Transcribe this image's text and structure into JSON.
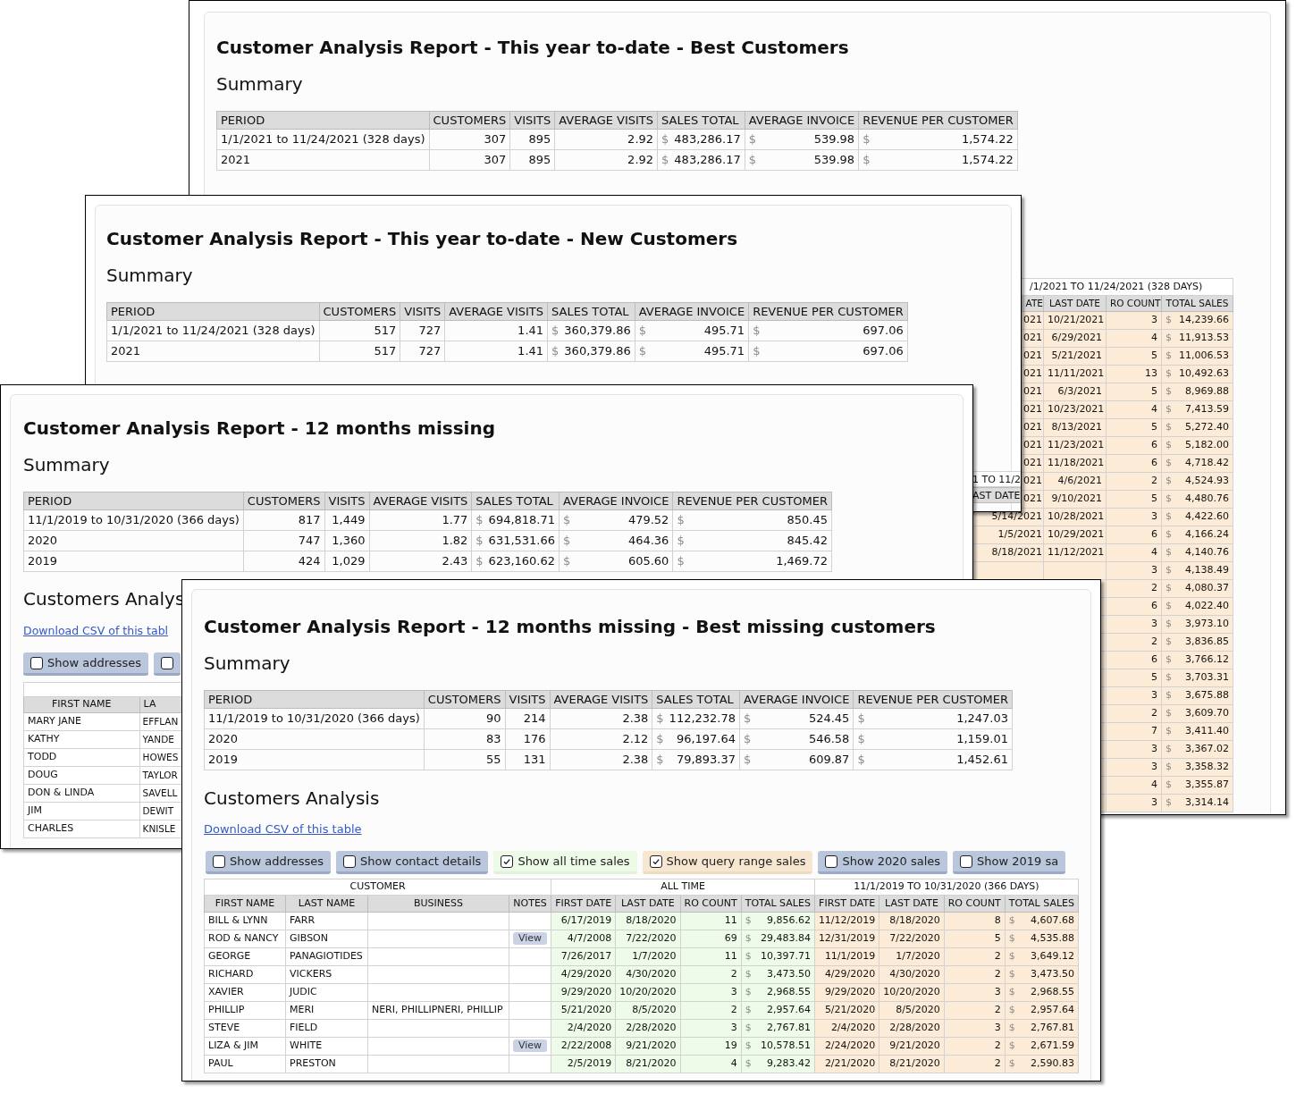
{
  "report_best_customers": {
    "title": "Customer Analysis Report - This year to-date - Best Customers",
    "summary_heading": "Summary",
    "summary_table": {
      "columns": [
        "PERIOD",
        "CUSTOMERS",
        "VISITS",
        "AVERAGE VISITS",
        "SALES TOTAL",
        "AVERAGE INVOICE",
        "REVENUE PER CUSTOMER"
      ],
      "rows": [
        [
          "1/1/2021 to 11/24/2021 (328 days)",
          "307",
          "895",
          "2.92",
          {
            "symbol": "$",
            "amount": "483,286.17"
          },
          {
            "symbol": "$",
            "amount": "539.98"
          },
          {
            "symbol": "$",
            "amount": "1,574.22"
          }
        ],
        [
          "2021",
          "307",
          "895",
          "2.92",
          {
            "symbol": "$",
            "amount": "483,286.17"
          },
          {
            "symbol": "$",
            "amount": "539.98"
          },
          {
            "symbol": "$",
            "amount": "1,574.22"
          }
        ]
      ]
    },
    "sales_table": {
      "range_header": "/1/2021 TO 11/24/2021 (328 DAYS)",
      "columns": [
        "ATE",
        "LAST DATE",
        "RO COUNT",
        "TOTAL SALES"
      ],
      "rows": [
        {
          "first_date": "021",
          "last_date": "10/21/2021",
          "ro_count": "3",
          "total_sales": {
            "symbol": "$",
            "amount": "14,239.66"
          }
        },
        {
          "first_date": "021",
          "last_date": "6/29/2021",
          "ro_count": "4",
          "total_sales": {
            "symbol": "$",
            "amount": "11,913.53"
          }
        },
        {
          "first_date": "021",
          "last_date": "5/21/2021",
          "ro_count": "5",
          "total_sales": {
            "symbol": "$",
            "amount": "11,006.53"
          }
        },
        {
          "first_date": "021",
          "last_date": "11/11/2021",
          "ro_count": "13",
          "total_sales": {
            "symbol": "$",
            "amount": "10,492.63"
          }
        },
        {
          "first_date": "021",
          "last_date": "6/3/2021",
          "ro_count": "5",
          "total_sales": {
            "symbol": "$",
            "amount": "8,969.88"
          }
        },
        {
          "first_date": "021",
          "last_date": "10/23/2021",
          "ro_count": "4",
          "total_sales": {
            "symbol": "$",
            "amount": "7,413.59"
          }
        },
        {
          "first_date": "021",
          "last_date": "8/13/2021",
          "ro_count": "5",
          "total_sales": {
            "symbol": "$",
            "amount": "5,272.40"
          }
        },
        {
          "first_date": "021",
          "last_date": "11/23/2021",
          "ro_count": "6",
          "total_sales": {
            "symbol": "$",
            "amount": "5,182.00"
          }
        },
        {
          "first_date": "021",
          "last_date": "11/18/2021",
          "ro_count": "6",
          "total_sales": {
            "symbol": "$",
            "amount": "4,718.42"
          }
        },
        {
          "first_date": "021",
          "last_date": "4/6/2021",
          "ro_count": "2",
          "total_sales": {
            "symbol": "$",
            "amount": "4,524.93"
          }
        },
        {
          "first_date": "021",
          "last_date": "9/10/2021",
          "ro_count": "5",
          "total_sales": {
            "symbol": "$",
            "amount": "4,480.76"
          }
        },
        {
          "first_date": "5/14/2021",
          "last_date": "10/28/2021",
          "ro_count": "3",
          "total_sales": {
            "symbol": "$",
            "amount": "4,422.60"
          }
        },
        {
          "first_date": "1/5/2021",
          "last_date": "10/29/2021",
          "ro_count": "6",
          "total_sales": {
            "symbol": "$",
            "amount": "4,166.24"
          }
        },
        {
          "first_date": "8/18/2021",
          "last_date": "11/12/2021",
          "ro_count": "4",
          "total_sales": {
            "symbol": "$",
            "amount": "4,140.76"
          }
        },
        {
          "ro_count": "3",
          "total_sales": {
            "symbol": "$",
            "amount": "4,138.49"
          }
        },
        {
          "ro_count": "2",
          "total_sales": {
            "symbol": "$",
            "amount": "4,080.37"
          }
        },
        {
          "ro_count": "6",
          "total_sales": {
            "symbol": "$",
            "amount": "4,022.40"
          }
        },
        {
          "ro_count": "3",
          "total_sales": {
            "symbol": "$",
            "amount": "3,973.10"
          }
        },
        {
          "ro_count": "2",
          "total_sales": {
            "symbol": "$",
            "amount": "3,836.85"
          }
        },
        {
          "ro_count": "6",
          "total_sales": {
            "symbol": "$",
            "amount": "3,766.12"
          }
        },
        {
          "ro_count": "5",
          "total_sales": {
            "symbol": "$",
            "amount": "3,703.31"
          }
        },
        {
          "ro_count": "3",
          "total_sales": {
            "symbol": "$",
            "amount": "3,675.88"
          }
        },
        {
          "ro_count": "2",
          "total_sales": {
            "symbol": "$",
            "amount": "3,609.70"
          }
        },
        {
          "ro_count": "7",
          "total_sales": {
            "symbol": "$",
            "amount": "3,411.40"
          }
        },
        {
          "ro_count": "3",
          "total_sales": {
            "symbol": "$",
            "amount": "3,367.02"
          }
        },
        {
          "ro_count": "3",
          "total_sales": {
            "symbol": "$",
            "amount": "3,358.32"
          }
        },
        {
          "ro_count": "4",
          "total_sales": {
            "symbol": "$",
            "amount": "3,355.87"
          }
        },
        {
          "ro_count": "3",
          "total_sales": {
            "symbol": "$",
            "amount": "3,314.14"
          }
        }
      ]
    }
  },
  "report_new_customers": {
    "title": "Customer Analysis Report - This year to-date - New Customers",
    "summary_heading": "Summary",
    "summary_table": {
      "columns": [
        "PERIOD",
        "CUSTOMERS",
        "VISITS",
        "AVERAGE VISITS",
        "SALES TOTAL",
        "AVERAGE INVOICE",
        "REVENUE PER CUSTOMER"
      ],
      "rows": [
        [
          "1/1/2021 to 11/24/2021 (328 days)",
          "517",
          "727",
          "1.41",
          {
            "symbol": "$",
            "amount": "360,379.86"
          },
          {
            "symbol": "$",
            "amount": "495.71"
          },
          {
            "symbol": "$",
            "amount": "697.06"
          }
        ],
        [
          "2021",
          "517",
          "727",
          "1.41",
          {
            "symbol": "$",
            "amount": "360,379.86"
          },
          {
            "symbol": "$",
            "amount": "495.71"
          },
          {
            "symbol": "$",
            "amount": "697.06"
          }
        ]
      ]
    },
    "table_fragment": {
      "range_header": "1 TO 11/2",
      "column": "AST DATE"
    }
  },
  "report_missing": {
    "title": "Customer Analysis Report - 12 months missing",
    "summary_heading": "Summary",
    "summary_table": {
      "columns": [
        "PERIOD",
        "CUSTOMERS",
        "VISITS",
        "AVERAGE VISITS",
        "SALES TOTAL",
        "AVERAGE INVOICE",
        "REVENUE PER CUSTOMER"
      ],
      "rows": [
        [
          "11/1/2019 to 10/31/2020 (366 days)",
          "817",
          "1,449",
          "1.77",
          {
            "symbol": "$",
            "amount": "694,818.71"
          },
          {
            "symbol": "$",
            "amount": "479.52"
          },
          {
            "symbol": "$",
            "amount": "850.45"
          }
        ],
        [
          "2020",
          "747",
          "1,360",
          "1.82",
          {
            "symbol": "$",
            "amount": "631,531.66"
          },
          {
            "symbol": "$",
            "amount": "464.36"
          },
          {
            "symbol": "$",
            "amount": "845.42"
          }
        ],
        [
          "2019",
          "424",
          "1,029",
          "2.43",
          {
            "symbol": "$",
            "amount": "623,160.62"
          },
          {
            "symbol": "$",
            "amount": "605.60"
          },
          {
            "symbol": "$",
            "amount": "1,469.72"
          }
        ]
      ]
    },
    "analysis_heading": "Customers Analys",
    "download_link": "Download CSV of this tabl",
    "buttons": [
      {
        "label": "Show addresses",
        "checked": false,
        "kind": "plain"
      },
      {
        "checked": false,
        "kind": "plain"
      }
    ],
    "customers_table": {
      "columns": [
        "FIRST NAME",
        "LA"
      ],
      "rows": [
        {
          "first_name": "MARY JANE",
          "last_name": "EFFLAN"
        },
        {
          "first_name": "KATHY",
          "last_name": "YANDE"
        },
        {
          "first_name": "TODD",
          "last_name": "HOWES"
        },
        {
          "first_name": "DOUG",
          "last_name": "TAYLOR"
        },
        {
          "first_name": "DON & LINDA",
          "last_name": "SAVELL"
        },
        {
          "first_name": "JIM",
          "last_name": "DEWIT"
        },
        {
          "first_name": "CHARLES",
          "last_name": "KNISLE"
        }
      ]
    }
  },
  "report_best_missing": {
    "title": "Customer Analysis Report - 12 months missing - Best missing customers",
    "summary_heading": "Summary",
    "summary_table": {
      "columns": [
        "PERIOD",
        "CUSTOMERS",
        "VISITS",
        "AVERAGE VISITS",
        "SALES TOTAL",
        "AVERAGE INVOICE",
        "REVENUE PER CUSTOMER"
      ],
      "rows": [
        [
          "11/1/2019 to 10/31/2020 (366 days)",
          "90",
          "214",
          "2.38",
          {
            "symbol": "$",
            "amount": "112,232.78"
          },
          {
            "symbol": "$",
            "amount": "524.45"
          },
          {
            "symbol": "$",
            "amount": "1,247.03"
          }
        ],
        [
          "2020",
          "83",
          "176",
          "2.12",
          {
            "symbol": "$",
            "amount": "96,197.64"
          },
          {
            "symbol": "$",
            "amount": "546.58"
          },
          {
            "symbol": "$",
            "amount": "1,159.01"
          }
        ],
        [
          "2019",
          "55",
          "131",
          "2.38",
          {
            "symbol": "$",
            "amount": "79,893.37"
          },
          {
            "symbol": "$",
            "amount": "609.87"
          },
          {
            "symbol": "$",
            "amount": "1,452.61"
          }
        ]
      ]
    },
    "analysis_heading": "Customers Analysis",
    "download_link": "Download CSV of this table",
    "buttons": [
      {
        "label": "Show addresses",
        "checked": false,
        "kind": "plain"
      },
      {
        "label": "Show contact details",
        "checked": false,
        "kind": "plain"
      },
      {
        "label": "Show all time sales",
        "checked": true,
        "kind": "all_time"
      },
      {
        "label": "Show query range sales",
        "checked": true,
        "kind": "query_range"
      },
      {
        "label": "Show 2020 sales",
        "checked": false,
        "kind": "plain"
      },
      {
        "label": "Show 2019 sa",
        "checked": false,
        "kind": "plain"
      }
    ],
    "customers_table": {
      "groups": [
        {
          "label": "CUSTOMER",
          "kind": "customer",
          "columns": [
            "FIRST NAME",
            "LAST NAME",
            "BUSINESS",
            "NOTES"
          ]
        },
        {
          "label": "ALL TIME",
          "kind": "all_time",
          "columns": [
            "FIRST DATE",
            "LAST DATE",
            "RO COUNT",
            "TOTAL SALES"
          ]
        },
        {
          "label": "11/1/2019 TO 10/31/2020 (366 DAYS)",
          "kind": "query_range",
          "columns": [
            "FIRST DATE",
            "LAST DATE",
            "RO COUNT",
            "TOTAL SALES"
          ]
        }
      ],
      "rows": [
        {
          "first_name": "BILL & LYNN",
          "last_name": "FARR",
          "all_time": [
            "6/17/2019",
            "8/18/2020",
            "11",
            {
              "symbol": "$",
              "amount": "9,856.62"
            }
          ],
          "query_range": [
            "11/12/2019",
            "8/18/2020",
            "8",
            {
              "symbol": "$",
              "amount": "4,607.68"
            }
          ]
        },
        {
          "first_name": "ROD & NANCY",
          "last_name": "GIBSON",
          "notes_button": "View",
          "all_time": [
            "4/7/2008",
            "7/22/2020",
            "69",
            {
              "symbol": "$",
              "amount": "29,483.84"
            }
          ],
          "query_range": [
            "12/31/2019",
            "7/22/2020",
            "5",
            {
              "symbol": "$",
              "amount": "4,535.88"
            }
          ]
        },
        {
          "first_name": "GEORGE",
          "last_name": "PANAGIOTIDES",
          "all_time": [
            "7/26/2017",
            "1/7/2020",
            "11",
            {
              "symbol": "$",
              "amount": "10,397.71"
            }
          ],
          "query_range": [
            "11/1/2019",
            "1/7/2020",
            "2",
            {
              "symbol": "$",
              "amount": "3,649.12"
            }
          ]
        },
        {
          "first_name": "RICHARD",
          "last_name": "VICKERS",
          "all_time": [
            "4/29/2020",
            "4/30/2020",
            "2",
            {
              "symbol": "$",
              "amount": "3,473.50"
            }
          ],
          "query_range": [
            "4/29/2020",
            "4/30/2020",
            "2",
            {
              "symbol": "$",
              "amount": "3,473.50"
            }
          ]
        },
        {
          "first_name": "XAVIER",
          "last_name": "JUDIC",
          "all_time": [
            "9/29/2020",
            "10/20/2020",
            "3",
            {
              "symbol": "$",
              "amount": "2,968.55"
            }
          ],
          "query_range": [
            "9/29/2020",
            "10/20/2020",
            "3",
            {
              "symbol": "$",
              "amount": "2,968.55"
            }
          ]
        },
        {
          "first_name": "PHILLIP",
          "last_name": "MERI",
          "business": "NERI, PHILLIPNERI, PHILLIP",
          "all_time": [
            "5/21/2020",
            "8/5/2020",
            "2",
            {
              "symbol": "$",
              "amount": "2,957.64"
            }
          ],
          "query_range": [
            "5/21/2020",
            "8/5/2020",
            "2",
            {
              "symbol": "$",
              "amount": "2,957.64"
            }
          ]
        },
        {
          "first_name": "STEVE",
          "last_name": "FIELD",
          "all_time": [
            "2/4/2020",
            "2/28/2020",
            "3",
            {
              "symbol": "$",
              "amount": "2,767.81"
            }
          ],
          "query_range": [
            "2/4/2020",
            "2/28/2020",
            "3",
            {
              "symbol": "$",
              "amount": "2,767.81"
            }
          ]
        },
        {
          "first_name": "LIZA & JIM",
          "last_name": "WHITE",
          "notes_button": "View",
          "all_time": [
            "2/22/2008",
            "9/21/2020",
            "19",
            {
              "symbol": "$",
              "amount": "10,578.51"
            }
          ],
          "query_range": [
            "2/24/2020",
            "9/21/2020",
            "2",
            {
              "symbol": "$",
              "amount": "2,671.59"
            }
          ]
        },
        {
          "first_name": "PAUL",
          "last_name": "PRESTON",
          "all_time": [
            "2/5/2019",
            "8/21/2020",
            "4",
            {
              "symbol": "$",
              "amount": "9,283.42"
            }
          ],
          "query_range": [
            "2/21/2020",
            "8/21/2020",
            "2",
            {
              "symbol": "$",
              "amount": "2,590.83"
            }
          ]
        }
      ]
    }
  }
}
